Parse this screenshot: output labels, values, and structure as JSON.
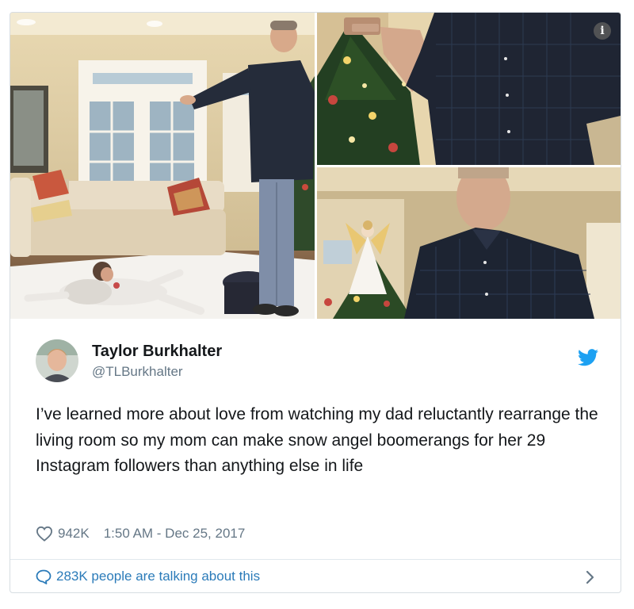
{
  "tweet": {
    "author": {
      "display_name": "Taylor Burkhalter",
      "handle": "@TLBurkhalter",
      "avatar_icon": "user-avatar-photo"
    },
    "text": "I’ve learned more about love from watching my dad reluctantly rearrange the living room so my mom can make snow angel boomerangs for her 29 Instagram followers than anything else in life",
    "likes": "942K",
    "timestamp": "1:50 AM - Dec 25, 2017",
    "talking_text": "283K people are talking about this",
    "media": {
      "photo_count": 3,
      "info_badge": "i"
    },
    "icons": {
      "brand": "twitter-bird-icon",
      "like": "heart-icon",
      "talking": "speech-bubble-icon",
      "more": "chevron-right-icon"
    }
  },
  "colors": {
    "brand": "#1da1f2",
    "link": "#2b7bb9",
    "text": "#14171a",
    "muted": "#657786",
    "border": "#d7dde2"
  }
}
